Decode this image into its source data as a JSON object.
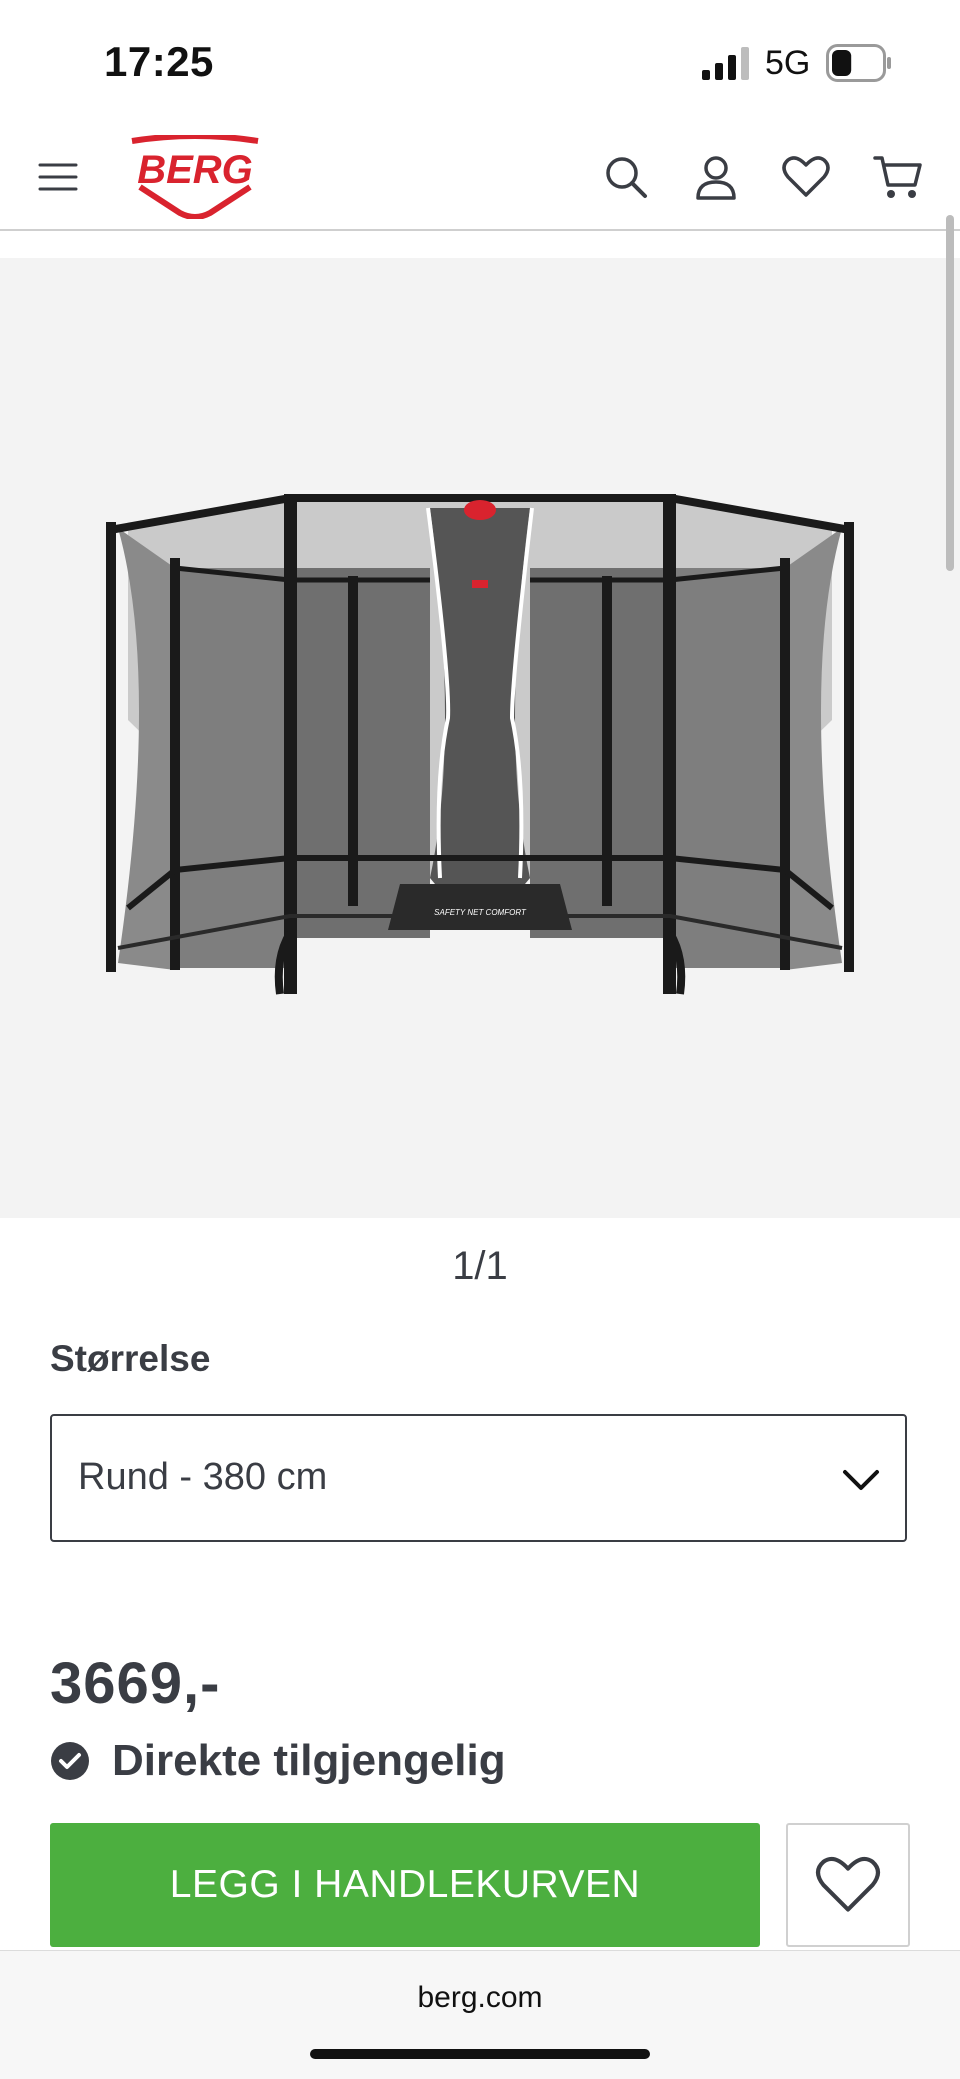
{
  "status_bar": {
    "time": "17:25",
    "network": "5G",
    "battery_level": 0.4
  },
  "header": {
    "menu_icon": "hamburger-icon",
    "logo_text": "BERG",
    "icons": [
      "search-icon",
      "account-icon",
      "heart-icon",
      "cart-icon"
    ]
  },
  "gallery": {
    "product_image": "trampoline-safety-net",
    "net_print": "SAFETY NET COMFORT",
    "counter": "1/1"
  },
  "size": {
    "label": "Størrelse",
    "selected": "Rund - 380 cm"
  },
  "price": "3669,-",
  "availability": "Direkte tilgjengelig",
  "actions": {
    "add_to_cart_label": "LEGG I HANDLEKURVEN"
  },
  "browser": {
    "url": "berg.com"
  },
  "colors": {
    "brand_red": "#d9232e",
    "button_green": "#4caf3f",
    "text": "#3a3d44"
  }
}
